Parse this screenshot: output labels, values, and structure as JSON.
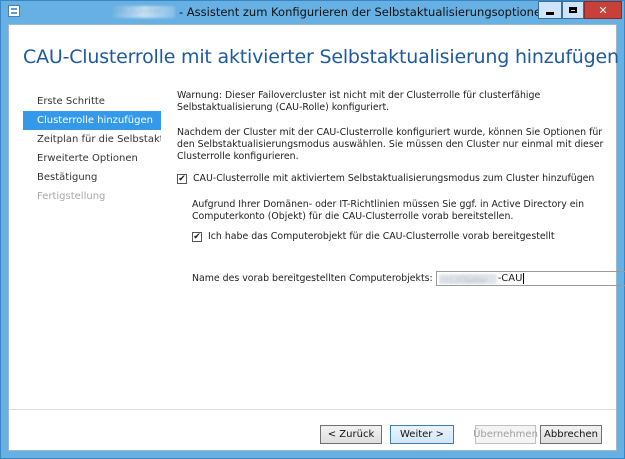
{
  "window": {
    "title": "- Assistent zum Konfigurieren der Selbstaktualisierungsoptionen",
    "title_prefix_redacted": "2012Cluster",
    "icons": [
      "window-icon",
      "minimize-icon",
      "maximize-icon",
      "close-icon"
    ]
  },
  "page": {
    "heading": "CAU-Clusterrolle mit aktivierter Selbstaktualisierung hinzufügen"
  },
  "nav": {
    "items": [
      {
        "label": "Erste Schritte",
        "state": "normal"
      },
      {
        "label": "Clusterrolle hinzufügen",
        "state": "active"
      },
      {
        "label": "Zeitplan für die Selbstakt...",
        "state": "normal"
      },
      {
        "label": "Erweiterte Optionen",
        "state": "normal"
      },
      {
        "label": "Bestätigung",
        "state": "normal"
      },
      {
        "label": "Fertigstellung",
        "state": "disabled"
      }
    ]
  },
  "content": {
    "warning": "Warnung: Dieser Failovercluster ist nicht mit der Clusterrolle für clusterfähige Selbstaktualisierung (CAU-Rolle) konfiguriert.",
    "info": "Nachdem der Cluster mit der CAU-Clusterrolle konfiguriert wurde, können Sie Optionen für den Selbstaktualisierungsmodus auswählen. Sie müssen den Cluster nur einmal mit dieser Clusterrolle konfigurieren.",
    "checkbox_add_role": {
      "label": "CAU-Clusterrolle mit aktiviertem Selbstaktualisierungsmodus zum Cluster hinzufügen",
      "checked": true
    },
    "policy_note": "Aufgrund Ihrer Domänen- oder IT-Richtlinien müssen Sie ggf. in Active Directory ein Computerkonto (Objekt) für die CAU-Clusterrolle vorab bereitstellen.",
    "checkbox_prestaged": {
      "label": "Ich habe das Computerobjekt für die CAU-Clusterrolle vorab bereitgestellt",
      "checked": true
    },
    "object_name_label": "Name des vorab bereitgestellten Computerobjekts:",
    "object_name_redacted": "2012Cluster",
    "object_name_suffix": "-CAU",
    "check_glyph": "✔"
  },
  "footer": {
    "back_label": "< Zurück",
    "next_label": "Weiter >",
    "install_label": "Übernehmen",
    "cancel_label": "Abbrechen"
  }
}
